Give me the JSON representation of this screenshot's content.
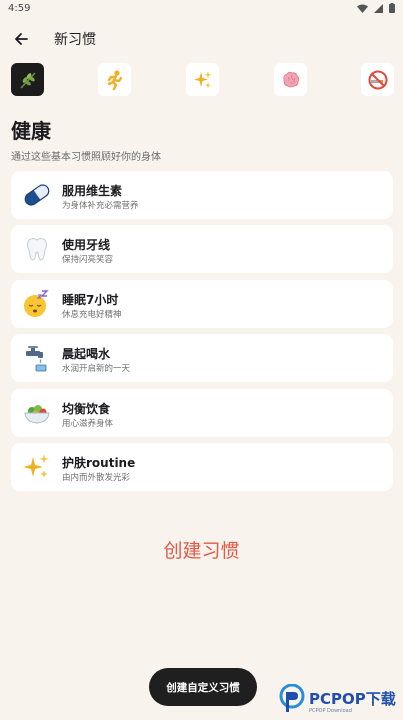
{
  "status_bar": {
    "time": "4:59"
  },
  "app_bar": {
    "title": "新习惯"
  },
  "categories": [
    {
      "icon": "herb-icon",
      "selected": true
    },
    {
      "icon": "running-person-icon",
      "selected": false
    },
    {
      "icon": "sparkles-icon",
      "selected": false
    },
    {
      "icon": "brain-icon",
      "selected": false
    },
    {
      "icon": "no-smoking-icon",
      "selected": false
    }
  ],
  "section": {
    "title": "健康",
    "subtitle": "通过这些基本习惯照顾好你的身体"
  },
  "habits": [
    {
      "name": "服用维生素",
      "desc": "为身体补充必需营养",
      "icon": "pill-icon"
    },
    {
      "name": "使用牙线",
      "desc": "保持闪亮笑容",
      "icon": "tooth-icon"
    },
    {
      "name": "睡眠7小时",
      "desc": "休息充电好精神",
      "icon": "sleeping-face-icon"
    },
    {
      "name": "晨起喝水",
      "desc": "水润开启新的一天",
      "icon": "water-tap-icon"
    },
    {
      "name": "均衡饮食",
      "desc": "用心滋养身体",
      "icon": "salad-icon"
    },
    {
      "name": "护肤routine",
      "desc": "由内而外散发光彩",
      "icon": "sparkles-icon"
    }
  ],
  "create_link": "创建习惯",
  "fab_label": "创建自定义习惯",
  "watermark": {
    "brand": "PCPOP下载",
    "small": "PCPOP Download"
  },
  "colors": {
    "background": "#f9f3ee",
    "accent": "#e05a47",
    "fab": "#1f1f1f"
  }
}
